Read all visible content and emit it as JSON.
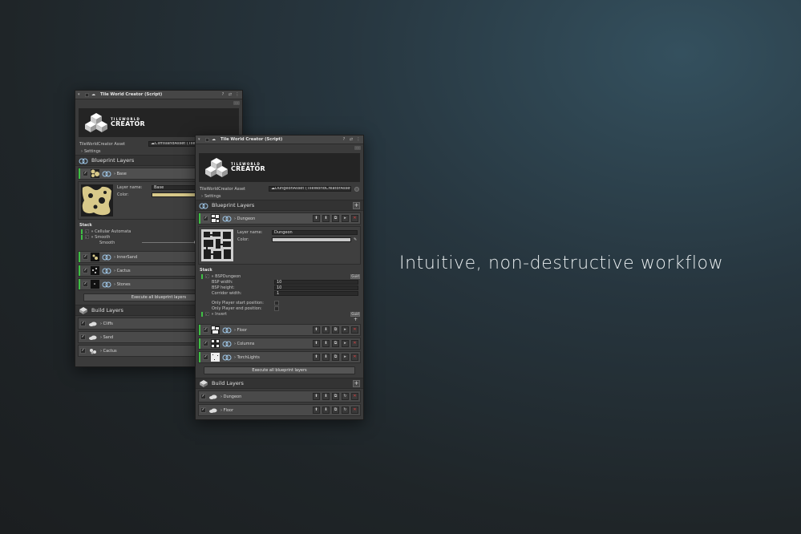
{
  "tagline": "Intuitive, non-destructive workflow",
  "colors": {
    "accent_green": "#3fbf45",
    "delete_red": "#e04040",
    "background": "#1f2528"
  },
  "back_panel": {
    "title": "Tile World Creator (Script)",
    "logo_top": "TILEWORLD",
    "logo_bottom": "CREATOR",
    "asset_label": "TileWorldCreator Asset",
    "asset_value": "☁CliffIslandAsset (TileW",
    "settings_label": "Settings",
    "blueprint_title": "Blueprint Layers",
    "base_layer": {
      "name": "Base",
      "layer_name_label": "Layer name:",
      "layer_name_value": "Base",
      "color_label": "Color:"
    },
    "stack_title": "Stack",
    "stack_items": [
      "Cellular Automata",
      "Smooth"
    ],
    "smooth_label": "Smooth",
    "other_layers": [
      "InnerSand",
      "Cactus",
      "Stones"
    ],
    "execute_label": "Execute all blueprint layers",
    "build_title": "Build Layers",
    "build_layers": [
      "Cliffs",
      "Sand",
      "Cactus"
    ]
  },
  "front_panel": {
    "title": "Tile World Creator (Script)",
    "logo_top": "TILEWORLD",
    "logo_bottom": "CREATOR",
    "asset_label": "TileWorldCreator Asset",
    "asset_value": "☁DungeonAsset (TileWorldCreatorAsset)",
    "settings_label": "Settings",
    "blueprint_title": "Blueprint Layers",
    "dungeon_layer": {
      "name": "Dungeon",
      "layer_name_label": "Layer name:",
      "layer_name_value": "Dungeon",
      "color_label": "Color:"
    },
    "stack_title": "Stack",
    "bsp": {
      "name": "BSPDungeon",
      "tag": "Guid",
      "width_label": "BSP width:",
      "width_value": "10",
      "height_label": "BSP height:",
      "height_value": "10",
      "corridor_label": "Corridor width:",
      "corridor_value": "1",
      "start_label": "Only Player start position:",
      "end_label": "Only Player end position:"
    },
    "invert": {
      "name": "Invert",
      "tag": "Guid"
    },
    "other_layers": [
      "Floor",
      "Columns",
      "TorchLights"
    ],
    "execute_label": "Execute all blueprint layers",
    "build_title": "Build Layers",
    "build_layers": [
      "Dungeon",
      "Floor"
    ]
  }
}
